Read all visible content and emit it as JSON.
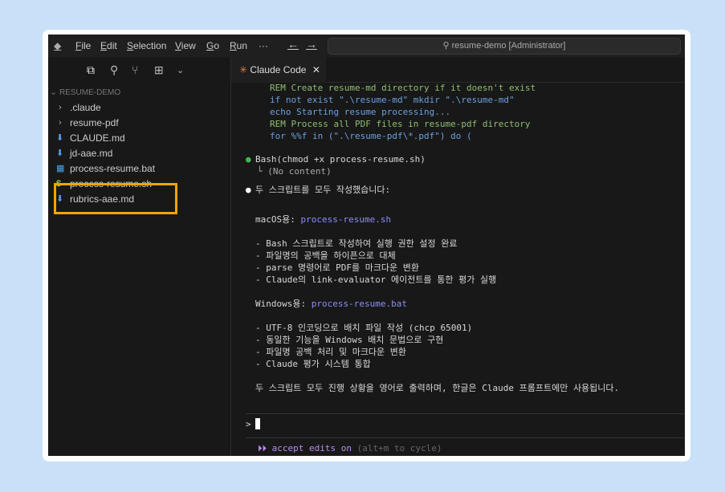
{
  "menu": {
    "items": [
      "File",
      "Edit",
      "Selection",
      "View",
      "Go",
      "Run",
      "···"
    ],
    "search": "resume-demo [Administrator]"
  },
  "sidebar": {
    "root": "RESUME-DEMO",
    "items": [
      {
        "label": ".claude",
        "icon": "chevron-right"
      },
      {
        "label": "resume-pdf",
        "icon": "chevron-right"
      },
      {
        "label": "CLAUDE.md",
        "icon": "markdown"
      },
      {
        "label": "jd-aae.md",
        "icon": "markdown"
      },
      {
        "label": "process-resume.bat",
        "icon": "windows"
      },
      {
        "label": "process-resume.sh",
        "icon": "dollar"
      },
      {
        "label": "rubrics-aae.md",
        "icon": "markdown"
      }
    ]
  },
  "tab": {
    "label": "Claude Code",
    "close": "✕"
  },
  "terminal": {
    "code": [
      "REM Create resume-md directory if it doesn't exist",
      "if not exist \".\\resume-md\" mkdir \".\\resume-md\"",
      "echo Starting resume processing...",
      "REM Process all PDF files in resume-pdf directory",
      "for %%f in (\".\\resume-pdf\\*.pdf\") do ("
    ],
    "bash": "Bash(chmod +x process-resume.sh)",
    "bash_result": "└ (No content)",
    "summary": "두 스크립트를 모두 작성했습니다:",
    "mac_label": "macOS용:",
    "mac_file": "process-resume.sh",
    "mac_points": [
      "- Bash 스크립트로 작성하여 실행 권한 설정 완료",
      "- 파일명의 공백을 하이픈으로 대체",
      "- parse 명령어로 PDF를 마크다운 변환",
      "- Claude의 link-evaluator 에이전트를 통한 평가 실행"
    ],
    "win_label": "Windows용:",
    "win_file": "process-resume.bat",
    "win_points": [
      "- UTF-8 인코딩으로 배치 파일 작성 (chcp 65001)",
      "- 동일한 기능을 Windows 배치 문법으로 구현",
      "- 파일명 공백 처리 및 마크다운 변환",
      "- Claude 평가 시스템 통합"
    ],
    "closing": "두 스크립트 모두 진행 상황을 영어로 출력하며, 한글은 Claude 프롬프트에만 사용됩니다.",
    "prompt": ">",
    "mode": "⏵⏵ accept edits on",
    "mode_hint": "(alt+m to cycle)"
  }
}
